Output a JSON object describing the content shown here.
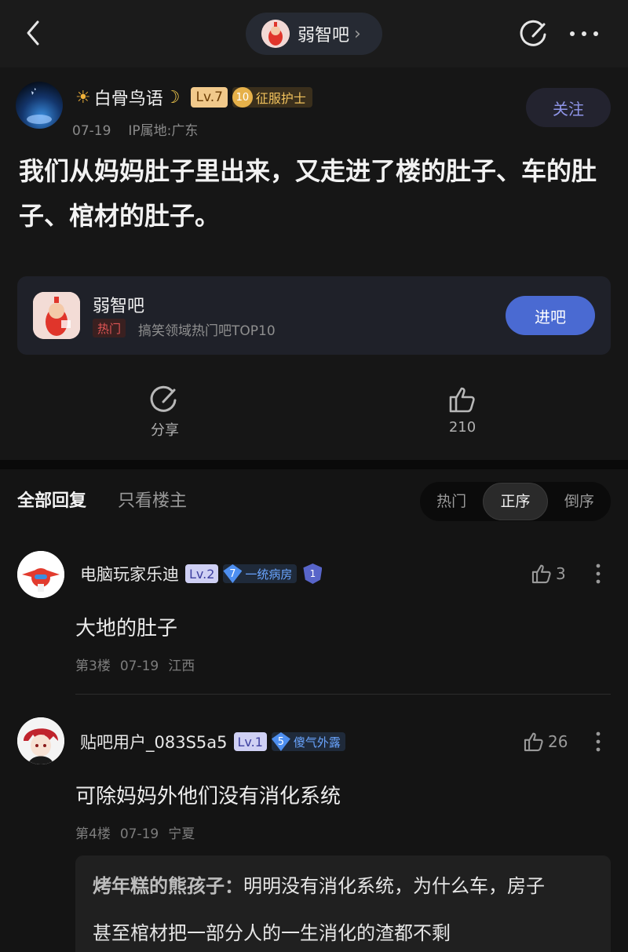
{
  "topbar": {
    "forum_name": "弱智吧",
    "chevron": "›",
    "icons": {
      "back": "chevron-left-icon",
      "edit": "edit-icon",
      "more": "more-dots-icon"
    }
  },
  "post": {
    "author_name": "白骨鸟语",
    "author_level": "Lv.7",
    "medal_number": "10",
    "medal_title": "征服护士",
    "date": "07-19",
    "ip": "IP属地:广东",
    "follow_label": "关注",
    "content": "我们从妈妈肚子里出来，又走进了楼的肚子、车的肚子、棺材的肚子。",
    "forum_card": {
      "name": "弱智吧",
      "hot_tag": "热门",
      "description": "搞笑领域热门吧TOP10",
      "enter_label": "进吧"
    },
    "share_label": "分享",
    "like_count": "210"
  },
  "replies_header": {
    "tab_all": "全部回复",
    "tab_op": "只看楼主",
    "sort_options": [
      "热门",
      "正序",
      "倒序"
    ],
    "sort_active": "正序"
  },
  "replies": [
    {
      "name": "电脑玩家乐迪",
      "level": "Lv.2",
      "medal_number": "7",
      "medal_title": "一统病房",
      "badge": "1",
      "likes": "3",
      "content": "大地的肚子",
      "floor": "第3楼",
      "date": "07-19",
      "location": "江西"
    },
    {
      "name": "贴吧用户_083S5a5",
      "level": "Lv.1",
      "medal_number": "5",
      "medal_title": "傻气外露",
      "likes": "26",
      "content": "可除妈妈外他们没有消化系统",
      "floor": "第4楼",
      "date": "07-19",
      "location": "宁夏",
      "sub_reply": {
        "author": "烤年糕的熊孩子：",
        "line1": "明明没有消化系统，为什么车，房子",
        "line2": "甚至棺材把一部分人的一生消化的渣都不剩"
      }
    }
  ],
  "colors": {
    "background": "#141414",
    "accent_blue": "#4a6ad2",
    "follow_text": "#8f95e8",
    "level_gold": "#f1c98b",
    "level_blue": "#cfd0f4"
  }
}
